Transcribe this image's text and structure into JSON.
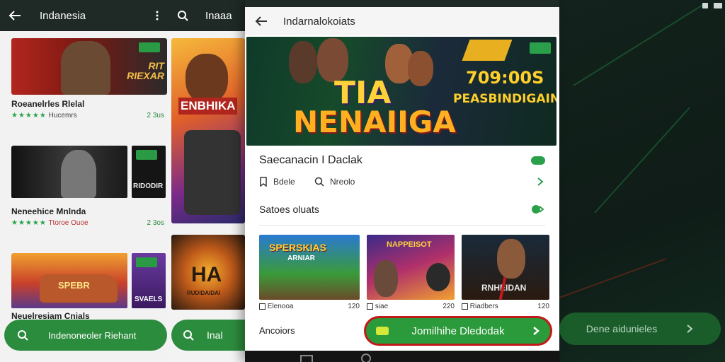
{
  "left_phone": {
    "title": "Indanesia",
    "cards": [
      {
        "name": "Roeanelrles Rlelal",
        "stars": "★★★★★",
        "sub": "Hucemrs",
        "count": "2 3us",
        "art_text": "RIT RIEXAR",
        "badge_text": ""
      },
      {
        "name": "Neneehice Mnlnda",
        "stars": "★★★★★",
        "sub": "Ttoroe Ouoe",
        "count": "2 3os",
        "art_text": "",
        "badge_text": "RIDODIR"
      },
      {
        "name": "Neuelresiam Cnials",
        "stars": "",
        "sub": "",
        "count": "",
        "art_text": "SPEBR",
        "badge_text": "SVAELS"
      }
    ],
    "pill_label": "Indenoneoler Riehant"
  },
  "mid_phone": {
    "title": "Inaaa",
    "art1_text": "ENBHIKA",
    "art2_text": "HA",
    "art2_sub": "RUDIDAIDAI",
    "pill_label": "Inal"
  },
  "front_phone": {
    "title": "Indarnalokoiats",
    "hero": {
      "line1": "TIA",
      "line2": "NENAIIGA",
      "score": "709:00S",
      "tag": "PEASBINDIGAINS"
    },
    "section1": {
      "title": "Saecanacin I Daclak",
      "item1": "Bdele",
      "item2": "Nreolo"
    },
    "section2": {
      "title": "Satoes oluats"
    },
    "tiles": [
      {
        "art_text": "SPERSKIAS",
        "art_sub": "ARNIAR",
        "label": "Elenooa",
        "count": "120"
      },
      {
        "art_text": "NAPPEISOT",
        "art_sub": "",
        "label": "siae",
        "count": "220"
      },
      {
        "art_text": "RNHEIDAN",
        "art_sub": "",
        "label": "Riadbers",
        "count": "120"
      }
    ],
    "bottom_label": "Ancoiors",
    "cta_label": "Jomilhihe Dledodak"
  },
  "right_panel": {
    "pill_label": "Dene aidunieles"
  },
  "colors": {
    "accent_green": "#2b9a3b",
    "highlight_red": "#c21a1a",
    "dark_bar": "#1f2a27"
  }
}
